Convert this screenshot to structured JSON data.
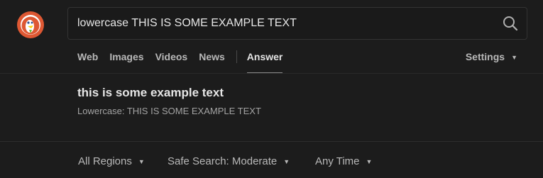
{
  "search": {
    "query": "lowercase THIS IS SOME EXAMPLE TEXT"
  },
  "icons": {
    "logo": "duck-logo-icon",
    "search": "search-icon",
    "dropdown": "caret-down-icon"
  },
  "colors": {
    "background": "#1c1c1c",
    "logo_red": "#de5833",
    "text_primary": "#e6e6e6",
    "text_secondary": "#b8b8b8"
  },
  "nav": {
    "tabs": [
      {
        "label": "Web",
        "active": false
      },
      {
        "label": "Images",
        "active": false
      },
      {
        "label": "Videos",
        "active": false
      },
      {
        "label": "News",
        "active": false
      },
      {
        "label": "Answer",
        "active": true
      }
    ],
    "settings_label": "Settings"
  },
  "answer": {
    "title": "this is some example text",
    "subtitle": "Lowercase: THIS IS SOME EXAMPLE TEXT"
  },
  "filters": {
    "region": "All Regions",
    "safe_search": "Safe Search: Moderate",
    "time": "Any Time"
  }
}
